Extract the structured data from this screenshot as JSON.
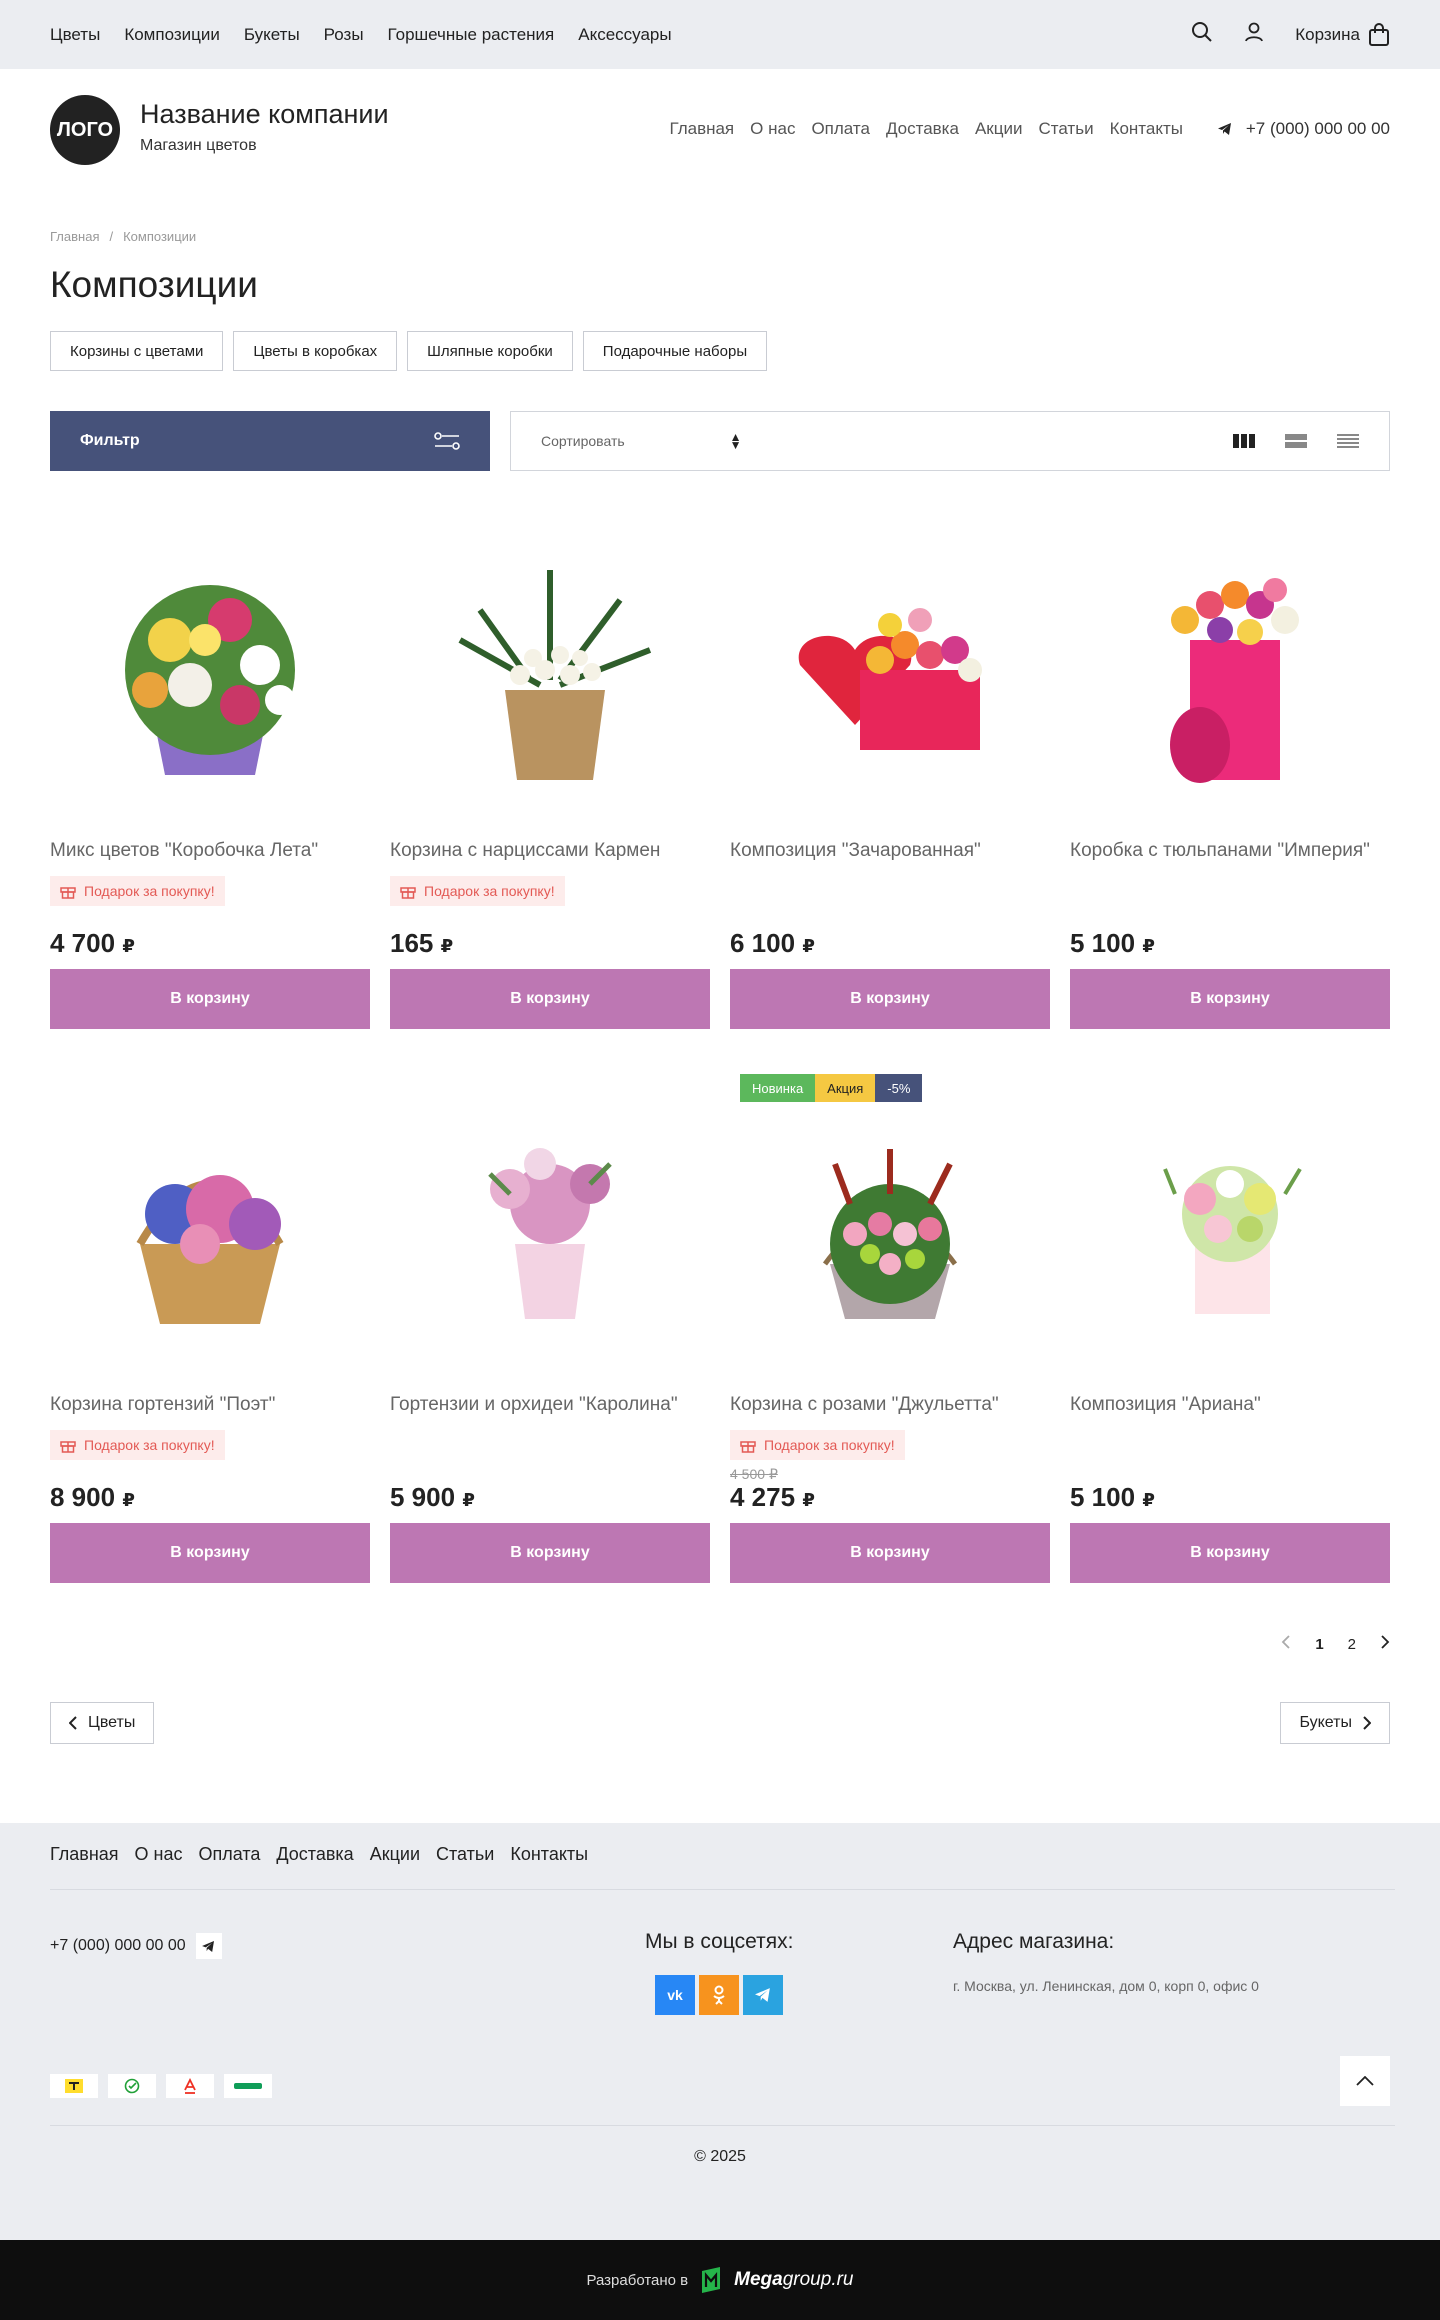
{
  "topbar": {
    "categories": [
      "Цветы",
      "Композиции",
      "Букеты",
      "Розы",
      "Горшечные растения",
      "Аксессуары"
    ],
    "cart_label": "Корзина"
  },
  "header": {
    "logo_text": "ЛОГО",
    "company_name": "Название компании",
    "tagline": "Магазин цветов",
    "nav": [
      "Главная",
      "О нас",
      "Оплата",
      "Доставка",
      "Акции",
      "Статьи",
      "Контакты"
    ],
    "phone": "+7 (000) 000 00 00"
  },
  "breadcrumb": {
    "home": "Главная",
    "separator": "/",
    "current": "Композиции"
  },
  "page_title": "Композиции",
  "subcategories": [
    "Корзины с цветами",
    "Цветы в коробках",
    "Шляпные коробки",
    "Подарочные наборы"
  ],
  "filter": {
    "label": "Фильтр",
    "sort_label": "Сортировать"
  },
  "currency": "₽",
  "products": [
    {
      "name": "Микс цветов \"Коробочка Лета\"",
      "gift": "Подарок за покупку!",
      "old_price": "",
      "price": "4 700",
      "button": "В корзину"
    },
    {
      "name": "Корзина с нарциссами Кармен",
      "gift": "Подарок за покупку!",
      "old_price": "",
      "price": "165",
      "button": "В корзину"
    },
    {
      "name": "Композиция \"Зачарованная\"",
      "gift": "",
      "old_price": "",
      "price": "6 100",
      "button": "В корзину"
    },
    {
      "name": "Коробка с тюльпанами \"Империя\"",
      "gift": "",
      "old_price": "",
      "price": "5 100",
      "button": "В корзину"
    },
    {
      "name": "Корзина гортензий \"Поэт\"",
      "gift": "Подарок за покупку!",
      "old_price": "",
      "price": "8 900",
      "button": "В корзину"
    },
    {
      "name": "Гортензии и орхидеи \"Каролина\"",
      "gift": "",
      "old_price": "",
      "price": "5 900",
      "button": "В корзину"
    },
    {
      "name": "Корзина с розами \"Джульетта\"",
      "gift": "Подарок за покупку!",
      "old_price": "4 500",
      "price": "4 275",
      "button": "В корзину",
      "badges": [
        "Новинка",
        "Акция",
        "-5%"
      ]
    },
    {
      "name": "Композиция \"Ариана\"",
      "gift": "",
      "old_price": "",
      "price": "5 100",
      "button": "В корзину"
    }
  ],
  "badge_colors": {
    "new": "#5cb85c",
    "sale": "#f5c842",
    "discount": "#46527a"
  },
  "accent_color": "#bd77b3",
  "pagination": {
    "pages": [
      "1",
      "2"
    ],
    "current": "1"
  },
  "nav_buttons": {
    "prev": "Цветы",
    "next": "Букеты"
  },
  "footer": {
    "nav": [
      "Главная",
      "О нас",
      "Оплата",
      "Доставка",
      "Акции",
      "Статьи",
      "Контакты"
    ],
    "phone": "+7 (000) 000 00 00",
    "socials_title": "Мы в соцсетях:",
    "address_title": "Адрес магазина:",
    "address": "г. Москва, ул. Ленинская, дом 0, корп 0, офис 0",
    "copyright": "© 2025"
  },
  "developer": {
    "prefix": "Разработано в",
    "brand_bold": "Mega",
    "brand_rest": "group.ru"
  }
}
